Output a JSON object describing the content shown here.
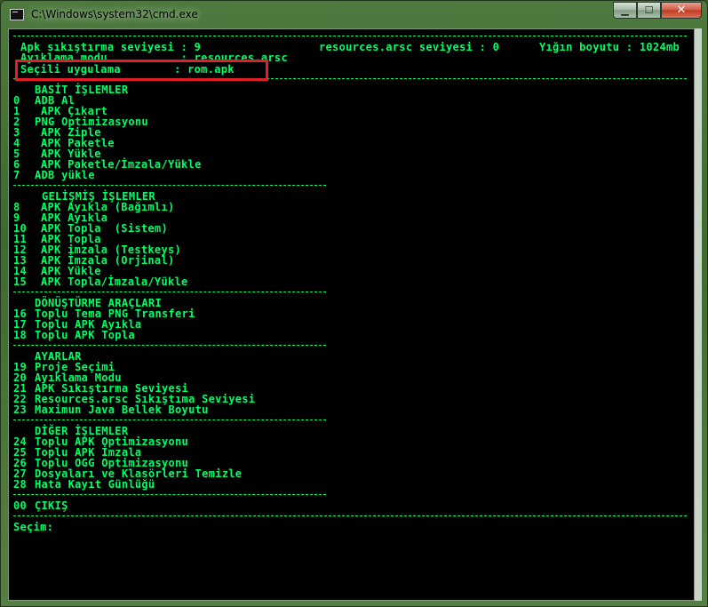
{
  "window": {
    "title": "C:\\Windows\\system32\\cmd.exe",
    "minimize_label": "▁",
    "maximize_label": "☐",
    "close_label": "✕"
  },
  "header": {
    "apk_compression": "Apk sıkıştırma seviyesi : 9",
    "resources_level": "resources.arsc seviyesi : 0",
    "heap_size": "Yığın boyutu : 1024mb",
    "decompile_mode": "Ayıklama modu           : resources.arsc",
    "selected_app": "Seçili uygulama        : rom.apk"
  },
  "sections": {
    "basic": {
      "title": "BASİT İŞLEMLER",
      "items": [
        {
          "num": "0",
          "label": "ADB Al"
        },
        {
          "num": "1",
          "label": "APK Çıkart"
        },
        {
          "num": "2",
          "label": "PNG Optimizasyonu"
        },
        {
          "num": "3",
          "label": "APK Ziple"
        },
        {
          "num": "4",
          "label": "APK Paketle"
        },
        {
          "num": "5",
          "label": "APK Yükle"
        },
        {
          "num": "6",
          "label": "APK Paketle/İmzala/Yükle"
        },
        {
          "num": "7",
          "label": "ADB yükle"
        }
      ]
    },
    "advanced": {
      "title": "GELİŞMİŞ İŞLEMLER",
      "items": [
        {
          "num": "8",
          "label": "APK Ayıkla (Bağımlı)"
        },
        {
          "num": "9",
          "label": "APK Ayıkla"
        },
        {
          "num": "10",
          "label": "APK Topla  (Sistem)"
        },
        {
          "num": "11",
          "label": "APK Topla"
        },
        {
          "num": "12",
          "label": "APK imzala (Testkeys)"
        },
        {
          "num": "13",
          "label": "APK İmzala (Orjinal)"
        },
        {
          "num": "14",
          "label": "APK Yükle"
        },
        {
          "num": "15",
          "label": "APK Topla/İmzala/Yükle"
        }
      ]
    },
    "conversion": {
      "title": "DÖNÜŞTÜRME ARAÇLARI",
      "items": [
        {
          "num": "16",
          "label": "Toplu Tema PNG Transferi"
        },
        {
          "num": "17",
          "label": "Toplu APK Ayıkla"
        },
        {
          "num": "18",
          "label": "Toplu APK Topla"
        }
      ]
    },
    "settings": {
      "title": "AYARLAR",
      "items": [
        {
          "num": "19",
          "label": "Proje Seçimi"
        },
        {
          "num": "20",
          "label": "Ayıklama Modu"
        },
        {
          "num": "21",
          "label": "APK Sıkıştırma Seviyesi"
        },
        {
          "num": "22",
          "label": "Resources.arsc Sıkıştıma Seviyesi"
        },
        {
          "num": "23",
          "label": "Maximun Java Bellek Boyutu"
        }
      ]
    },
    "other": {
      "title": "DİĞER İŞLEMLER",
      "items": [
        {
          "num": "24",
          "label": "Toplu APK Optimizasyonu"
        },
        {
          "num": "25",
          "label": "Toplu APK İmzala"
        },
        {
          "num": "26",
          "label": "Toplu OGG Optimizasyonu"
        },
        {
          "num": "27",
          "label": "Dosyaları ve Klasörleri Temizle"
        },
        {
          "num": "28",
          "label": "Hata Kayıt Günlüğü"
        }
      ]
    }
  },
  "exit": {
    "num": "00",
    "label": "ÇIKIŞ"
  },
  "prompt": "Seçim:",
  "colors": {
    "console_bg": "#000000",
    "console_text": "#00ff66",
    "highlight_box": "#e01f26"
  }
}
